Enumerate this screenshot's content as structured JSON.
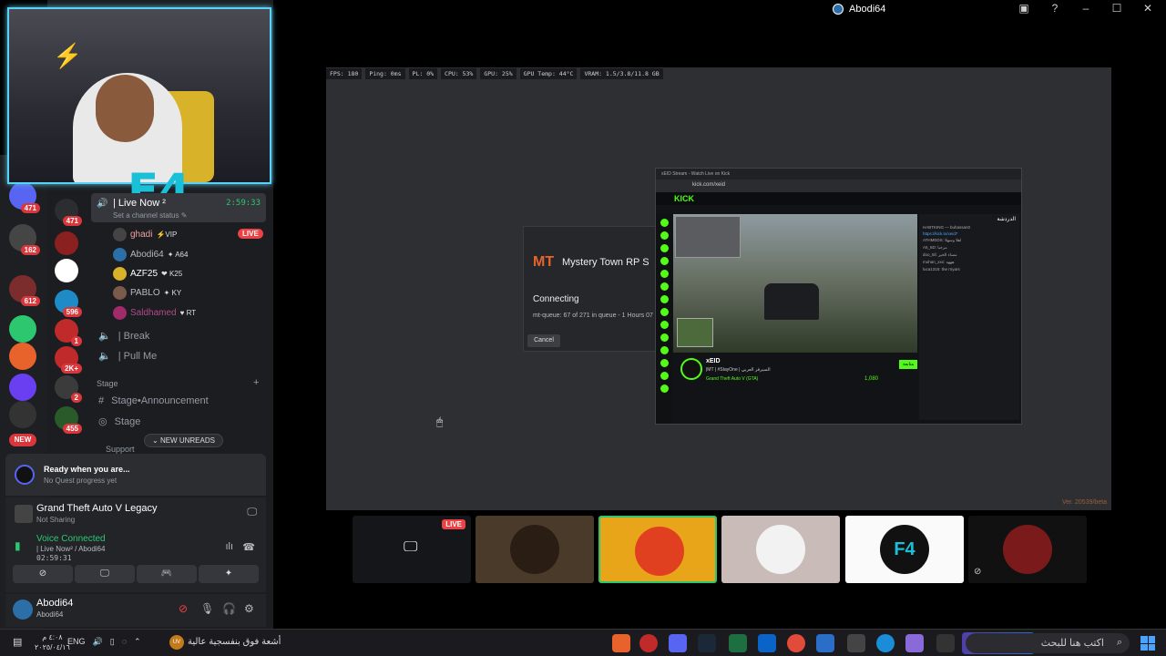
{
  "window": {
    "title": "Abodi64"
  },
  "voice_channel": {
    "name": "| Live Now ²",
    "time": "2:59:33",
    "status_placeholder": "Set a channel status ✎",
    "live_badge": "LIVE"
  },
  "members": [
    {
      "name": "ghadi",
      "role": "⚡VIP"
    },
    {
      "name": "Abodi64",
      "role": "✦ A64"
    },
    {
      "name": "AZF25",
      "role": "❤ K25"
    },
    {
      "name": "PABLO",
      "role": "✦ KY"
    },
    {
      "name": "Saldhamed",
      "role": "♥ RT"
    }
  ],
  "channels": {
    "break": "| Break",
    "pull_me": "| Pull Me",
    "stage_category": "Stage",
    "stage_announcement": "Stage•Announcement",
    "stage": "Stage",
    "support_category": "Support",
    "new_unreads": "NEW UNREADS"
  },
  "guild_badges": [
    "471",
    "162",
    "612",
    "596",
    "1",
    "2K+",
    "2",
    "455",
    "NEW"
  ],
  "quest": {
    "title": "Ready when you are...",
    "subtitle": "No Quest progress yet"
  },
  "game": {
    "title": "Grand Theft Auto V Legacy",
    "status": "Not Sharing"
  },
  "voice": {
    "status": "Voice Connected",
    "channel": "| Live Now² / Abodi64",
    "timer": "02:59:31"
  },
  "user": {
    "name": "Abodi64",
    "tag": "Abodi64"
  },
  "perf": [
    "FPS: 180",
    "Ping: 0ms",
    "PL: 0%",
    "CPU: 53%",
    "GPU: 25%",
    "GPU Temp: 44°C",
    "VRAM: 1.5/3.8/11.8 GB"
  ],
  "game_dialog": {
    "logo": "MT",
    "server": "Mystery Town RP S",
    "connecting": "Connecting",
    "queue": "mt-queue: 67 of 271 in queue - 1 Hours 07 Mi",
    "cancel": "Cancel"
  },
  "version": "Ver. 20539/beta",
  "browser": {
    "tab": "xEID Stream - Watch Live on Kick",
    "url": "kick.com/xeid",
    "site": "KICK",
    "streamer": "xEID",
    "title": "|MT | #StayOne | السيرفر العربي",
    "category": "Grand Theft Auto V (GTA)",
    "viewers": "1,080",
    "follow": "متابعة",
    "chat_title": "الدردشة",
    "chat_lines": [
      "HABTKING — buhassan0",
      "https://kick.to/xeid7",
      "ATHMEDS: اهلا وسهلا",
      "A5_6D: مرحبا",
      "doo_5il: مساء الخير",
      "mohan_xxx: هههه",
      "luca1315: the rnyars"
    ]
  },
  "tiles": {
    "live_badge": "LIVE"
  },
  "taskbar": {
    "search_placeholder": "اكتب هنا للبحث",
    "news": "أشعة فوق بنفسجية عالية",
    "news_badge": "UV",
    "lang": "ENG",
    "time": "٤:٠٨ م",
    "date": "٢٠٢٥/٠٤/١٦"
  }
}
